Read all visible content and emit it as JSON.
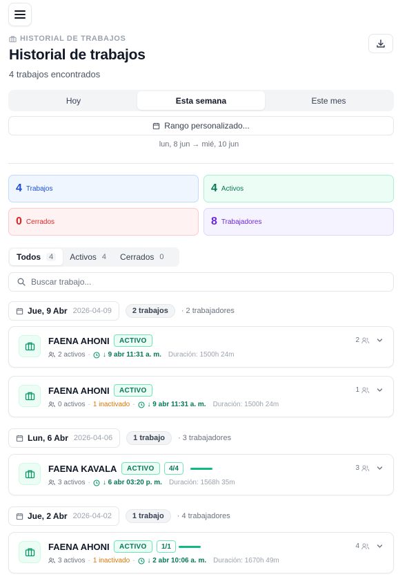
{
  "header": {
    "eyebrow": "HISTORIAL DE TRABAJOS",
    "title": "Historial de trabajos",
    "subtitle": "4 trabajos encontrados"
  },
  "periods": [
    "Hoy",
    "Esta semana",
    "Este mes"
  ],
  "active_period": "Esta semana",
  "range_button": "Rango personalizado...",
  "range_text": "lun, 8 jun → mié, 10 jun",
  "stats": [
    {
      "value": "4",
      "label": "Trabajos",
      "color": "#1d4ed8"
    },
    {
      "value": "4",
      "label": "Activos",
      "color": "#047857"
    },
    {
      "value": "0",
      "label": "Cerrados",
      "color": "#dc2626"
    },
    {
      "value": "8",
      "label": "Trabajadores",
      "color": "#6d28d9"
    }
  ],
  "filters": [
    {
      "label": "Todos",
      "count": "4"
    },
    {
      "label": "Activos",
      "count": "4"
    },
    {
      "label": "Cerrados",
      "count": "0"
    }
  ],
  "search_placeholder": "Buscar trabajo...",
  "groups": [
    {
      "date": "Jue, 9 Abr",
      "iso": "2026-04-09",
      "count": "2 trabajos",
      "workers": "· 2 trabajadores",
      "jobs": [
        {
          "name": "FAENA AHONI",
          "status": "ACTIVO",
          "ratio": "",
          "active": "2 activos",
          "inactive": "",
          "time": "↓ 9 abr 11:31 a. m.",
          "duration": "Duración: 1500h 24m",
          "workers": "2"
        },
        {
          "name": "FAENA AHONI",
          "status": "ACTIVO",
          "ratio": "",
          "active": "0 activos",
          "inactive": "1 inactivado",
          "time": "↓ 9 abr 11:31 a. m.",
          "duration": "Duración: 1500h 24m",
          "workers": "1"
        }
      ]
    },
    {
      "date": "Lun, 6 Abr",
      "iso": "2026-04-06",
      "count": "1 trabajo",
      "workers": "· 3 trabajadores",
      "jobs": [
        {
          "name": "FAENA KAVALA",
          "status": "ACTIVO",
          "ratio": "4/4",
          "active": "3 activos",
          "inactive": "",
          "time": "↓ 6 abr 03:20 p. m.",
          "duration": "Duración: 1568h 35m",
          "workers": "3"
        }
      ]
    },
    {
      "date": "Jue, 2 Abr",
      "iso": "2026-04-02",
      "count": "1 trabajo",
      "workers": "· 4 trabajadores",
      "jobs": [
        {
          "name": "FAENA AHONI",
          "status": "ACTIVO",
          "ratio": "1/1",
          "active": "3 activos",
          "inactive": "1 inactivado",
          "time": "↓ 2 abr 10:06 a. m.",
          "duration": "Duración: 1670h 49m",
          "workers": "4"
        }
      ]
    }
  ]
}
